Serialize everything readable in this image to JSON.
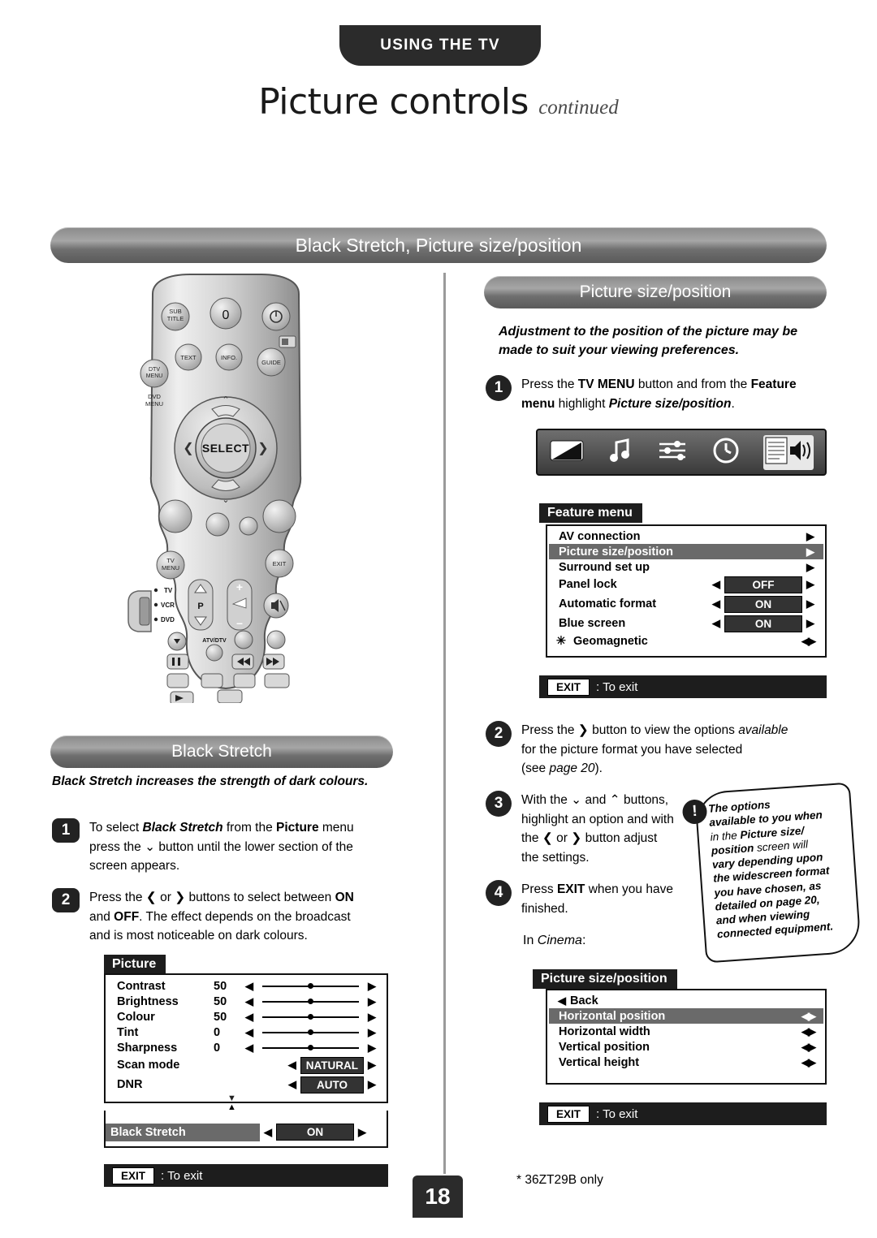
{
  "header": {
    "tab_label": "USING THE TV",
    "title_main": "Picture controls",
    "title_cont": "continued"
  },
  "banners": {
    "main": "Black Stretch, Picture size/position",
    "picture_size_position": "Picture size/position",
    "black_stretch": "Black Stretch"
  },
  "right_column": {
    "intro_line1": "Adjustment to the position of the picture may be",
    "intro_line2": "made to suit your viewing preferences.",
    "step1": {
      "number": "1",
      "t1": "Press the ",
      "t2": "TV MENU",
      "t3": " button and from the ",
      "t4": "Feature",
      "t5": "menu",
      "t6": " highlight ",
      "t7": "Picture size/position",
      "t8": "."
    },
    "step2": {
      "number": "2",
      "t1": "Press the ",
      "t2": "❯",
      "t3": " button to view the options ",
      "t4": "available",
      "t5": "for the picture format you have selected",
      "t6": "(see ",
      "t7": "page 20",
      "t8": ")."
    },
    "step3": {
      "number": "3",
      "t1": "With the ",
      "t2": " and ",
      "t3": " buttons,",
      "t4": "highlight an option and with",
      "t5": "the ",
      "t6": " or ",
      "t7": " button adjust",
      "t8": "the settings."
    },
    "step4": {
      "number": "4",
      "t1": "Press ",
      "t2": "EXIT",
      "t3": " when you have",
      "t4": "finished."
    },
    "in_cinema_label": "In ",
    "in_cinema_value": "Cinema",
    "in_cinema_colon": ":",
    "callout": {
      "bang": "!",
      "line1": "The options",
      "line2": "available to you when",
      "line3_a": "in the ",
      "line3_b": "Picture size/",
      "line4_a": "position",
      "line4_b": " screen will",
      "line5": "vary depending upon",
      "line6": "the widescreen format",
      "line7": "you have chosen, as",
      "line8": "detailed on page 20,",
      "line9": "and when viewing",
      "line10": "connected equipment."
    }
  },
  "left_column": {
    "bs_intro_a": "Black Stretch",
    "bs_intro_b": " increases the strength of dark colours.",
    "step1": {
      "number": "1",
      "t1": "To select ",
      "t2": "Black Stretch",
      "t3": " from the ",
      "t4": "Picture",
      "t5": " menu",
      "t6": "press the ",
      "t7": " button until the lower section of the",
      "t8": "screen appears."
    },
    "step2": {
      "number": "2",
      "t1": "Press the ",
      "t2": "❮",
      "t3": " or ",
      "t4": "❯",
      "t5": " buttons to select between ",
      "t6": "ON",
      "t7": "and ",
      "t8": "OFF",
      "t9": ". The effect depends on the broadcast",
      "t10": "and is most noticeable on dark colours."
    }
  },
  "osd_picture": {
    "title": "Picture",
    "rows": [
      {
        "label": "Contrast",
        "value": "50",
        "type": "slider"
      },
      {
        "label": "Brightness",
        "value": "50",
        "type": "slider"
      },
      {
        "label": "Colour",
        "value": "50",
        "type": "slider"
      },
      {
        "label": "Tint",
        "value": "0",
        "type": "slider"
      },
      {
        "label": "Sharpness",
        "value": "0",
        "type": "slider"
      },
      {
        "label": "Scan mode",
        "value": "NATURAL",
        "type": "box"
      },
      {
        "label": "DNR",
        "value": "AUTO",
        "type": "box"
      }
    ],
    "lower_row": {
      "label": "Black Stretch",
      "value": "ON"
    },
    "exit_button": "EXIT",
    "exit_text": ": To exit"
  },
  "osd_feature": {
    "title": "Feature menu",
    "rows": [
      {
        "label": "AV connection",
        "value": "",
        "highlight": false,
        "star": false
      },
      {
        "label": "Picture size/position",
        "value": "",
        "highlight": true,
        "star": false
      },
      {
        "label": "Surround set up",
        "value": "",
        "highlight": false,
        "star": false
      },
      {
        "label": "Panel lock",
        "value": "OFF",
        "highlight": false,
        "star": false
      },
      {
        "label": "Automatic format",
        "value": "ON",
        "highlight": false,
        "star": false
      },
      {
        "label": "Blue screen",
        "value": "ON",
        "highlight": false,
        "star": false
      },
      {
        "label": "Geomagnetic",
        "value": "",
        "highlight": false,
        "star": true
      }
    ],
    "exit_button": "EXIT",
    "exit_text": ": To exit"
  },
  "osd_psp": {
    "title": "Picture size/position",
    "back_label": "Back",
    "rows": [
      {
        "label": "Horizontal  position",
        "highlight": true
      },
      {
        "label": "Horizontal  width",
        "highlight": false
      },
      {
        "label": "Vertical  position",
        "highlight": false
      },
      {
        "label": "Vertical  height",
        "highlight": false
      }
    ],
    "exit_button": "EXIT",
    "exit_text": ": To exit"
  },
  "remote": {
    "buttons": {
      "subtitle": "SUB\nTITLE",
      "zero": "0",
      "text": "TEXT",
      "info": "INFO.",
      "dtv_menu": "DTV\nMENU",
      "guide": "GUIDE",
      "dvd_menu": "DVD\nMENU",
      "select": "SELECT",
      "tv_menu": "TV\nMENU",
      "exit": "EXIT",
      "p": "P",
      "plus": "+",
      "minus": "–",
      "tv": "TV",
      "vcr": "VCR",
      "dvd": "DVD",
      "atv_dtv": "ATV/DTV"
    }
  },
  "footer": {
    "page_number": "18",
    "footnote": "* 36ZT29B only"
  }
}
